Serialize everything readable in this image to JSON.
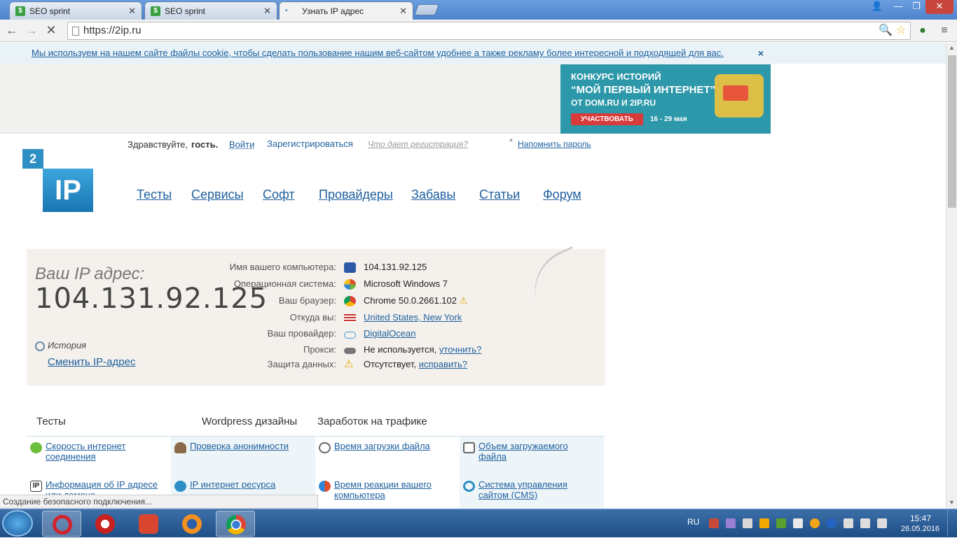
{
  "browser": {
    "tabs": [
      {
        "title": "SEO sprint",
        "favicon": "seosprint-icon"
      },
      {
        "title": "SEO sprint",
        "favicon": "seosprint-icon"
      },
      {
        "title": "Узнать IP адрес",
        "favicon": "loading-icon"
      }
    ],
    "url": "https://2ip.ru",
    "status_text": "Создание безопасного подключения..."
  },
  "cookie_notice": {
    "text": "Мы используем на нашем сайте файлы cookie, чтобы сделать пользование нашим веб-сайтом удобнее а также рекламу более интересной и подходящей для вас.",
    "close": "×"
  },
  "banner": {
    "line1": "КОНКУРС ИСТОРИЙ",
    "line2": "“МОЙ ПЕРВЫЙ ИНТЕРНЕТ”",
    "line3": "ОТ DOM.RU И 2IP.RU",
    "button": "УЧАСТВОВАТЬ",
    "dates": "16 - 29 мая"
  },
  "userbar": {
    "greeting": "Здравствуйте,",
    "guest": "гость.",
    "login": "Войти",
    "register": "Зарегистрироваться",
    "why_register": "Что дает регистрация?",
    "star": "*",
    "remind_password": "Напомнить пароль"
  },
  "logo": {
    "two": "2",
    "ip": "IP"
  },
  "nav": [
    "Тесты",
    "Сервисы",
    "Софт",
    "Провайдеры",
    "Забавы",
    "Статьи",
    "Форум"
  ],
  "ip_box": {
    "caption": "Ваш IP адрес:",
    "ip": "104.131.92.125",
    "history": "История",
    "change_ip": "Сменить IP-адрес",
    "rows": [
      {
        "label": "Имя вашего компьютера:",
        "value": "104.131.92.125",
        "icon": "computer-icon"
      },
      {
        "label": "Операционная система:",
        "value": "Microsoft Windows 7",
        "icon": "windows-icon"
      },
      {
        "label": "Ваш браузер:",
        "value": "Chrome 50.0.2661.102",
        "icon": "chrome-icon"
      },
      {
        "label": "Откуда вы:",
        "value": "United States, New York",
        "icon": "us-flag-icon"
      },
      {
        "label": "Ваш провайдер:",
        "value": "DigitalOcean",
        "icon": "cloud-icon"
      },
      {
        "label": "Прокси:",
        "value": "Не используется,",
        "link": "уточнить?",
        "icon": "glasses-icon"
      },
      {
        "label": "Защита данных:",
        "value": "Отсутствует,",
        "link": "исправить?",
        "icon": "warning-icon"
      }
    ]
  },
  "sections": {
    "tests": "Тесты",
    "wordpress": "Wordpress дизайны",
    "earnings": "Заработок на трафике"
  },
  "test_links": [
    "Скорость интернет соединения",
    "Проверка анонимности",
    "Время загрузки файла",
    "Объем загружаемого файла",
    "Информация об IP адресе или домене",
    "IP интернет ресурса",
    "Время реакции вашего компьютера",
    "Система управления сайтом (CMS)"
  ],
  "taskbar": {
    "apps": [
      "opera",
      "nero",
      "ccleaner",
      "firefox",
      "chrome"
    ],
    "lang": "RU",
    "time": "15:47",
    "date": "26.05.2016"
  },
  "colors": {
    "link": "#1e5f9e",
    "ipbox_bg": "#f4f1ec",
    "banner_bg": "#2c98a9",
    "taskbar": "#1e4d86"
  }
}
